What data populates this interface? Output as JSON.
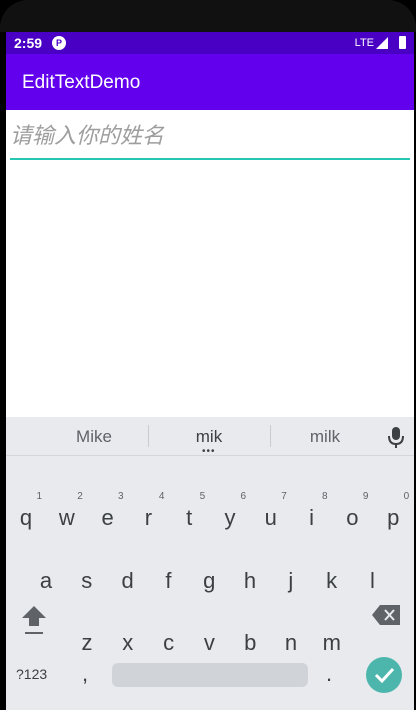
{
  "status_bar": {
    "time": "2:59",
    "app_icon_glyph": "P",
    "network": "LTE",
    "signal_icon": "signal-icon",
    "battery_icon": "battery-icon"
  },
  "app_bar": {
    "title": "EditTextDemo",
    "color": "#6200ee",
    "status_color": "#4a00c4"
  },
  "form": {
    "name_placeholder": "请输入你的姓名",
    "name_value": "",
    "underline_color": "#26c6b5"
  },
  "keyboard": {
    "suggestions": [
      "Mike",
      "mik",
      "milk"
    ],
    "mic_icon": "mic-icon",
    "row1": [
      {
        "key": "q",
        "hint": "1"
      },
      {
        "key": "w",
        "hint": "2"
      },
      {
        "key": "e",
        "hint": "3"
      },
      {
        "key": "r",
        "hint": "4"
      },
      {
        "key": "t",
        "hint": "5"
      },
      {
        "key": "y",
        "hint": "6"
      },
      {
        "key": "u",
        "hint": "7"
      },
      {
        "key": "i",
        "hint": "8"
      },
      {
        "key": "o",
        "hint": "9"
      },
      {
        "key": "p",
        "hint": "0"
      }
    ],
    "row2": [
      "a",
      "s",
      "d",
      "f",
      "g",
      "h",
      "j",
      "k",
      "l"
    ],
    "row3": [
      "z",
      "x",
      "c",
      "v",
      "b",
      "n",
      "m"
    ],
    "bottom": {
      "symbols": "?123",
      "comma": ",",
      "period": "."
    },
    "enter_color": "#4db6ac"
  }
}
